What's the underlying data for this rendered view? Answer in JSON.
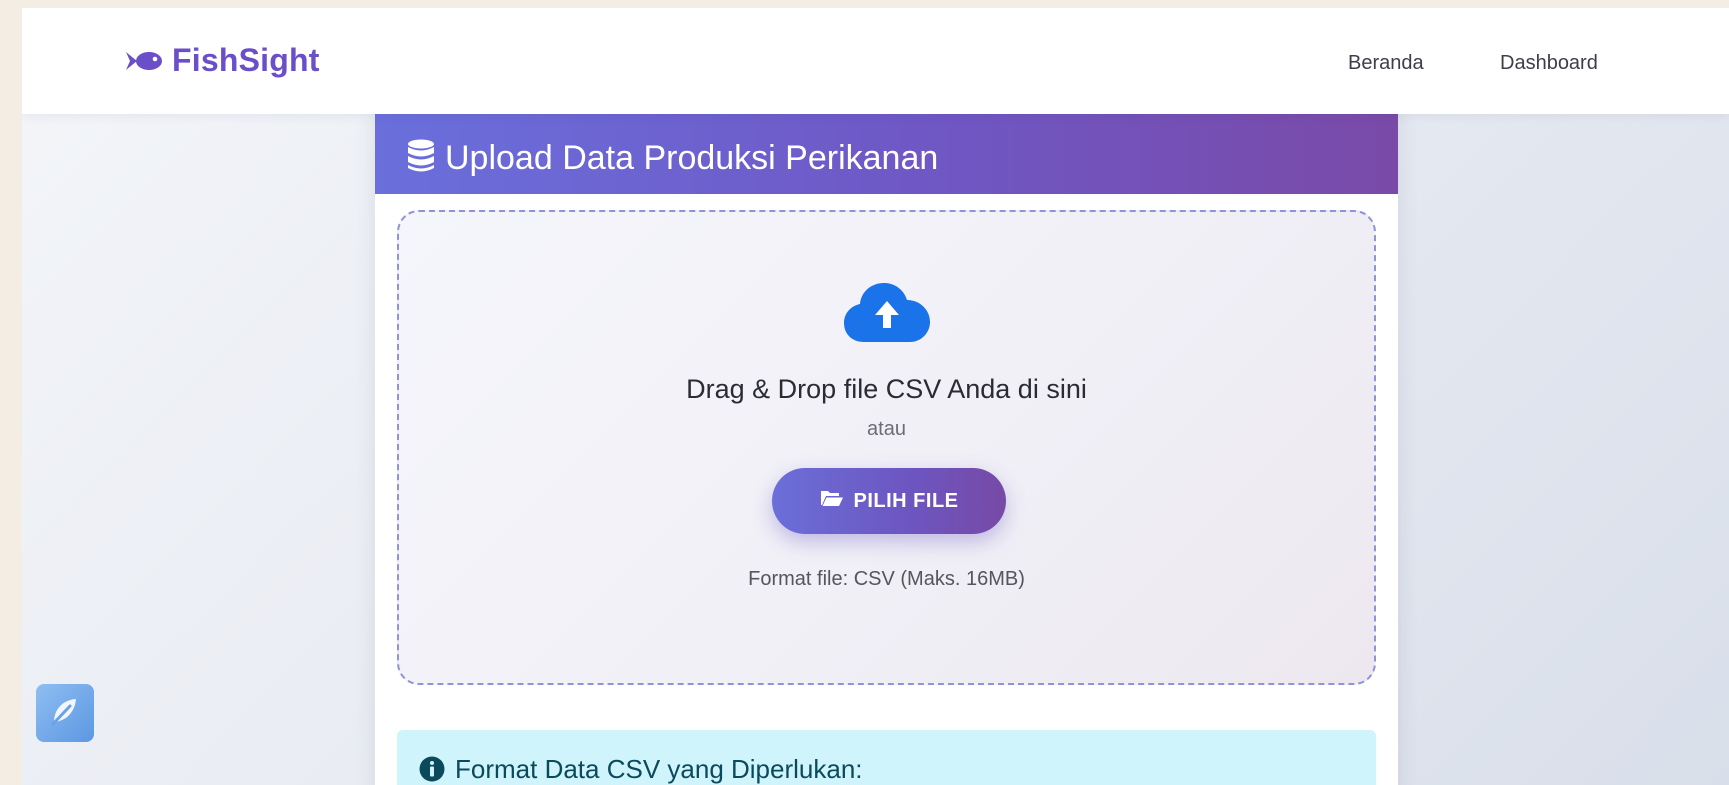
{
  "navbar": {
    "brand": "FishSight",
    "links": [
      "Beranda",
      "Dashboard"
    ]
  },
  "upload_card": {
    "title": "Upload Data Produksi Perikanan",
    "dropzone": {
      "title": "Drag & Drop file CSV Anda di sini",
      "or_text": "atau",
      "button_label": "PILIH FILE",
      "format_note": "Format file: CSV (Maks. 16MB)"
    },
    "info": {
      "title": "Format Data CSV yang Diperlukan:"
    }
  },
  "icons": {
    "brand": "fish-icon",
    "header": "database-icon",
    "upload": "cloud-upload-icon",
    "button": "folder-open-icon",
    "info": "info-circle-icon",
    "floating": "feather-icon"
  },
  "colors": {
    "brand": "#6a4fc8",
    "header_gradient_start": "#6a6fdc",
    "header_gradient_end": "#7a4aa8",
    "upload_icon": "#1a73e8",
    "info_background": "#cff4fb",
    "dropzone_border": "#8f93d8"
  }
}
